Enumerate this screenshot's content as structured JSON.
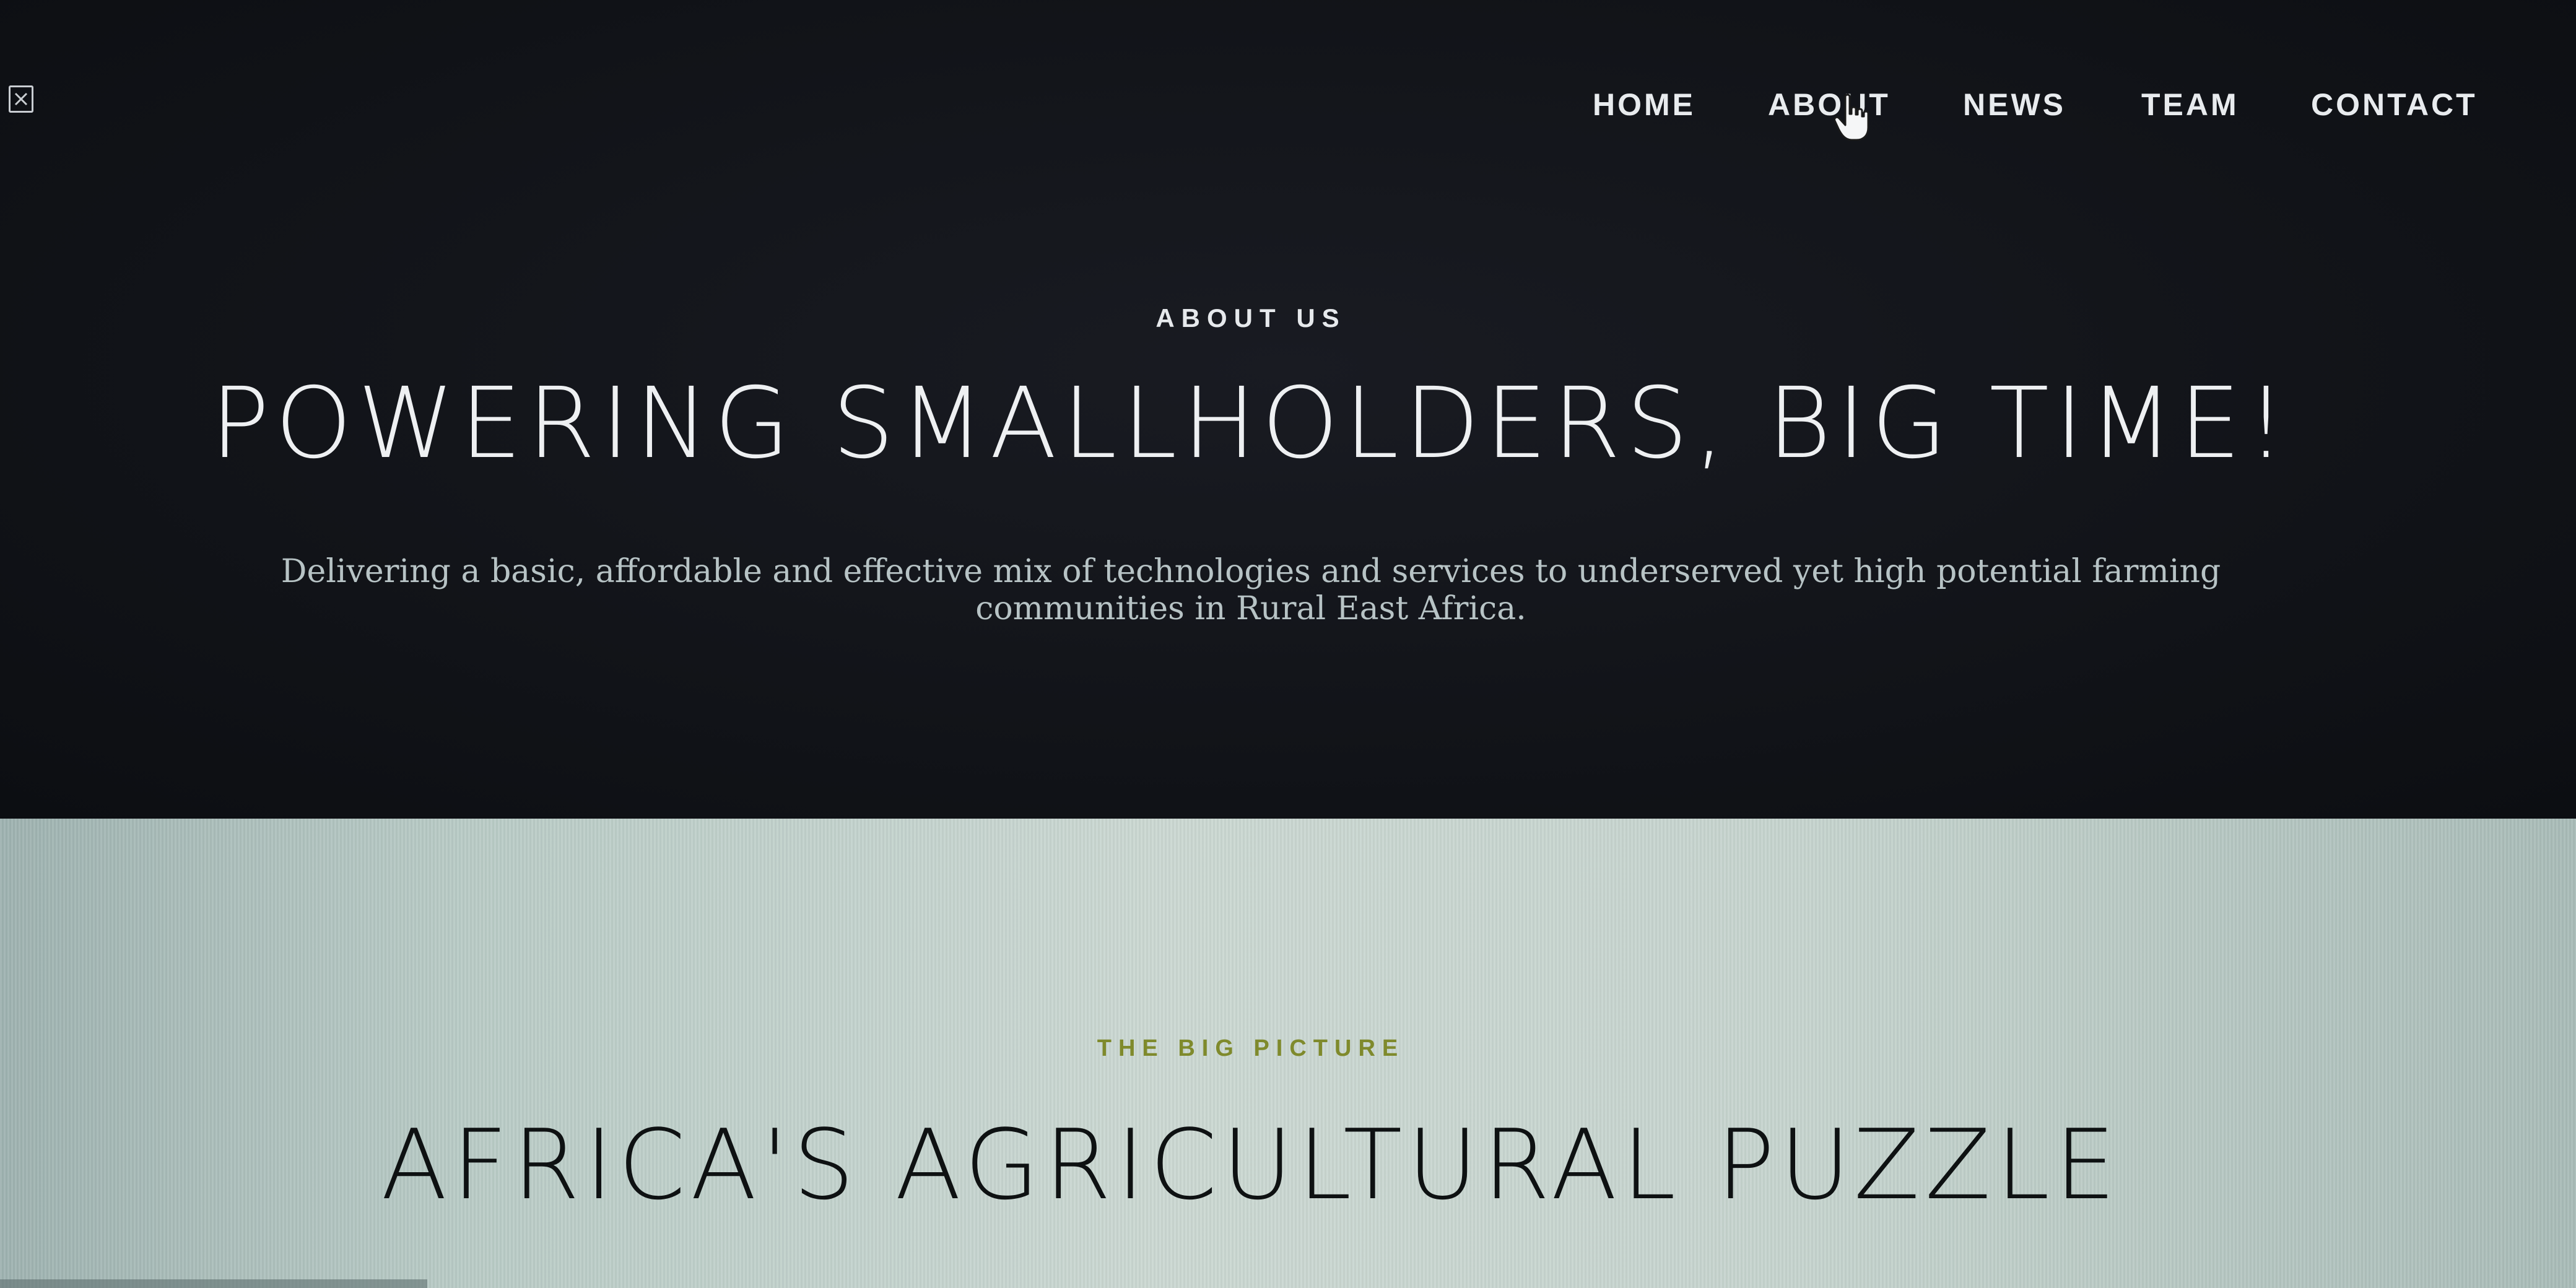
{
  "nav": {
    "items": [
      {
        "label": "HOME"
      },
      {
        "label": "ABOUT"
      },
      {
        "label": "NEWS"
      },
      {
        "label": "TEAM"
      },
      {
        "label": "CONTACT"
      }
    ]
  },
  "icons": {
    "broken_image": "broken-image-icon",
    "cursor": "hand-cursor-icon"
  },
  "about": {
    "eyebrow": "ABOUT US",
    "title": "POWERING SMALLHOLDERS, BIG TIME!",
    "description": "Delivering a basic, affordable and effective mix of technologies and services to underserved yet high potential farming communities in Rural East Africa."
  },
  "big_picture": {
    "eyebrow": "THE BIG PICTURE",
    "title": "AFRICA'S AGRICULTURAL PUZZLE"
  },
  "colors": {
    "hero_bg": "#121419",
    "light_bg": "#c6d4ce",
    "accent_olive": "#7f8a2c",
    "text_light": "#eef0f2",
    "text_dark": "#0e1112"
  }
}
